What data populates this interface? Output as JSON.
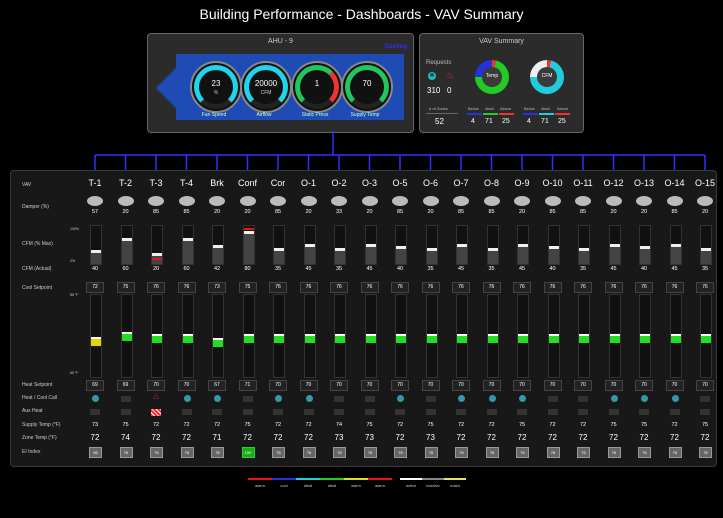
{
  "title": "Building Performance   -   Dashboards   -   VAV Summary",
  "ahu": {
    "title": "AHU - 9",
    "mode": "Cooling",
    "gauges": [
      {
        "value": "23",
        "unit": "%",
        "label": "Fan Speed",
        "color": "#22d3ee"
      },
      {
        "value": "20000",
        "unit": "CFM",
        "label": "Airflow",
        "color": "#22d3ee"
      },
      {
        "value": "1",
        "unit": "",
        "label": "Static Press",
        "color": "#22c55e"
      },
      {
        "value": "70",
        "unit": "",
        "label": "Supply Temp",
        "color": "#22c55e"
      }
    ]
  },
  "vav_summary": {
    "title": "VAV Summary",
    "requests_label": "Requests",
    "cool_requests": "310",
    "heat_requests": "0",
    "zones_label": "# of Zones",
    "zones_count": "52",
    "temp_donut_label": "Temp",
    "cfm_donut_label": "CFM",
    "temp_stats": {
      "below": "4",
      "ideal": "71",
      "above": "25"
    },
    "cfm_stats": {
      "below": "4",
      "ideal": "71",
      "above": "25"
    },
    "below_label": "Below",
    "ideal_label": "Ideal",
    "above_label": "Above"
  },
  "row_labels": {
    "vav": "VAV",
    "damper": "Damper (%)",
    "cfm_max": "CFM (% Max)",
    "scale_100": "100%",
    "scale_0": "0%",
    "cfm_actual": "CFM (Actual)",
    "cool_sp": "Cool Setpoint",
    "scale_top": "85 °F",
    "scale_bottom": "65 °F",
    "heat_sp": "Heat Setpoint",
    "heat_cool_call": "Heat / Cool Call",
    "aux_heat": "Aux Heat",
    "supply_temp": "Supply Temp (°F)",
    "zone_temp": "Zone Temp (°F)",
    "ei_index": "EI Index"
  },
  "columns": [
    {
      "name": "T-1",
      "damper": "57",
      "cfm_pct": 30,
      "cfm": "40",
      "cool_sp": "72",
      "heat_sp": "69",
      "supply": "73",
      "zone": "72",
      "ei": "96",
      "call": "cool",
      "aux": false,
      "zone_pct": 0.42,
      "zone_color": "#e8d500"
    },
    {
      "name": "T-2",
      "damper": "20",
      "cfm_pct": 60,
      "cfm": "60",
      "cool_sp": "75",
      "heat_sp": "69",
      "supply": "75",
      "zone": "74",
      "ei": "76",
      "call": "",
      "aux": false,
      "zone_pct": 0.47,
      "zone_color": "#22dd22"
    },
    {
      "name": "T-3",
      "damper": "85",
      "cfm_pct": 20,
      "cfm": "20",
      "cool_sp": "76",
      "heat_sp": "70",
      "supply": "72",
      "zone": "72",
      "ei": "76",
      "call": "heat",
      "aux": true,
      "zone_pct": 0.45,
      "zone_color": "#22dd22"
    },
    {
      "name": "T-4",
      "damper": "85",
      "cfm_pct": 60,
      "cfm": "60",
      "cool_sp": "76",
      "heat_sp": "70",
      "supply": "72",
      "zone": "72",
      "ei": "76",
      "call": "cool",
      "aux": false,
      "zone_pct": 0.45,
      "zone_color": "#22dd22"
    },
    {
      "name": "Brk",
      "damper": "20",
      "cfm_pct": 42,
      "cfm": "42",
      "cool_sp": "73",
      "heat_sp": "67",
      "supply": "72",
      "zone": "71",
      "ei": "76",
      "call": "cool",
      "aux": false,
      "zone_pct": 0.4,
      "zone_color": "#22dd22"
    },
    {
      "name": "Conf",
      "damper": "20",
      "cfm_pct": 80,
      "cfm": "80",
      "cool_sp": "75",
      "heat_sp": "71",
      "supply": "75",
      "zone": "72",
      "ei": "100",
      "call": "",
      "aux": false,
      "zone_pct": 0.45,
      "zone_color": "#22dd22"
    },
    {
      "name": "Cor",
      "damper": "85",
      "cfm_pct": 35,
      "cfm": "35",
      "cool_sp": "76",
      "heat_sp": "70",
      "supply": "72",
      "zone": "72",
      "ei": "76",
      "call": "cool",
      "aux": false,
      "zone_pct": 0.45,
      "zone_color": "#22dd22"
    },
    {
      "name": "O-1",
      "damper": "20",
      "cfm_pct": 45,
      "cfm": "45",
      "cool_sp": "76",
      "heat_sp": "70",
      "supply": "72",
      "zone": "72",
      "ei": "76",
      "call": "cool",
      "aux": false,
      "zone_pct": 0.45,
      "zone_color": "#22dd22"
    },
    {
      "name": "O-2",
      "damper": "33",
      "cfm_pct": 35,
      "cfm": "35",
      "cool_sp": "76",
      "heat_sp": "70",
      "supply": "74",
      "zone": "73",
      "ei": "76",
      "call": "",
      "aux": false,
      "zone_pct": 0.45,
      "zone_color": "#22dd22"
    },
    {
      "name": "O-3",
      "damper": "20",
      "cfm_pct": 45,
      "cfm": "45",
      "cool_sp": "76",
      "heat_sp": "70",
      "supply": "75",
      "zone": "73",
      "ei": "76",
      "call": "",
      "aux": false,
      "zone_pct": 0.45,
      "zone_color": "#22dd22"
    },
    {
      "name": "O-5",
      "damper": "85",
      "cfm_pct": 40,
      "cfm": "40",
      "cool_sp": "76",
      "heat_sp": "70",
      "supply": "72",
      "zone": "72",
      "ei": "76",
      "call": "cool",
      "aux": false,
      "zone_pct": 0.45,
      "zone_color": "#22dd22"
    },
    {
      "name": "O-6",
      "damper": "20",
      "cfm_pct": 35,
      "cfm": "35",
      "cool_sp": "76",
      "heat_sp": "70",
      "supply": "75",
      "zone": "73",
      "ei": "76",
      "call": "",
      "aux": false,
      "zone_pct": 0.45,
      "zone_color": "#22dd22"
    },
    {
      "name": "O-7",
      "damper": "85",
      "cfm_pct": 45,
      "cfm": "45",
      "cool_sp": "76",
      "heat_sp": "70",
      "supply": "72",
      "zone": "72",
      "ei": "76",
      "call": "cool",
      "aux": false,
      "zone_pct": 0.45,
      "zone_color": "#22dd22"
    },
    {
      "name": "O-8",
      "damper": "85",
      "cfm_pct": 35,
      "cfm": "35",
      "cool_sp": "76",
      "heat_sp": "70",
      "supply": "72",
      "zone": "72",
      "ei": "76",
      "call": "cool",
      "aux": false,
      "zone_pct": 0.45,
      "zone_color": "#22dd22"
    },
    {
      "name": "O-9",
      "damper": "20",
      "cfm_pct": 45,
      "cfm": "45",
      "cool_sp": "76",
      "heat_sp": "70",
      "supply": "75",
      "zone": "72",
      "ei": "76",
      "call": "cool",
      "aux": false,
      "zone_pct": 0.45,
      "zone_color": "#22dd22"
    },
    {
      "name": "O-10",
      "damper": "85",
      "cfm_pct": 40,
      "cfm": "40",
      "cool_sp": "76",
      "heat_sp": "70",
      "supply": "72",
      "zone": "72",
      "ei": "76",
      "call": "",
      "aux": false,
      "zone_pct": 0.45,
      "zone_color": "#22dd22"
    },
    {
      "name": "O-11",
      "damper": "85",
      "cfm_pct": 35,
      "cfm": "35",
      "cool_sp": "76",
      "heat_sp": "70",
      "supply": "72",
      "zone": "72",
      "ei": "76",
      "call": "",
      "aux": false,
      "zone_pct": 0.45,
      "zone_color": "#22dd22"
    },
    {
      "name": "O-12",
      "damper": "20",
      "cfm_pct": 45,
      "cfm": "45",
      "cool_sp": "76",
      "heat_sp": "70",
      "supply": "75",
      "zone": "72",
      "ei": "76",
      "call": "cool",
      "aux": false,
      "zone_pct": 0.45,
      "zone_color": "#22dd22"
    },
    {
      "name": "O-13",
      "damper": "20",
      "cfm_pct": 40,
      "cfm": "40",
      "cool_sp": "76",
      "heat_sp": "70",
      "supply": "75",
      "zone": "72",
      "ei": "76",
      "call": "cool",
      "aux": false,
      "zone_pct": 0.45,
      "zone_color": "#22dd22"
    },
    {
      "name": "O-14",
      "damper": "85",
      "cfm_pct": 45,
      "cfm": "45",
      "cool_sp": "76",
      "heat_sp": "70",
      "supply": "72",
      "zone": "72",
      "ei": "76",
      "call": "cool",
      "aux": false,
      "zone_pct": 0.45,
      "zone_color": "#22dd22"
    },
    {
      "name": "O-15",
      "damper": "20",
      "cfm_pct": 35,
      "cfm": "35",
      "cool_sp": "76",
      "heat_sp": "70",
      "supply": "75",
      "zone": "72",
      "ei": "76",
      "call": "",
      "aux": false,
      "zone_pct": 0.45,
      "zone_color": "#22dd22"
    }
  ],
  "legend": [
    {
      "label": "alarm",
      "color": "#e11"
    },
    {
      "label": "cool",
      "color": "#2233dd"
    },
    {
      "label": "ideal",
      "color": "#22ccdd"
    },
    {
      "label": "ideal",
      "color": "#22cc22"
    },
    {
      "label": "warm",
      "color": "#dddd22"
    },
    {
      "label": "alarm",
      "color": "#e11"
    },
    {
      "label": "active",
      "color": "#ffffff"
    },
    {
      "label": "inactive",
      "color": "#888888"
    },
    {
      "label": "maint",
      "color": "#e8e06a"
    }
  ]
}
